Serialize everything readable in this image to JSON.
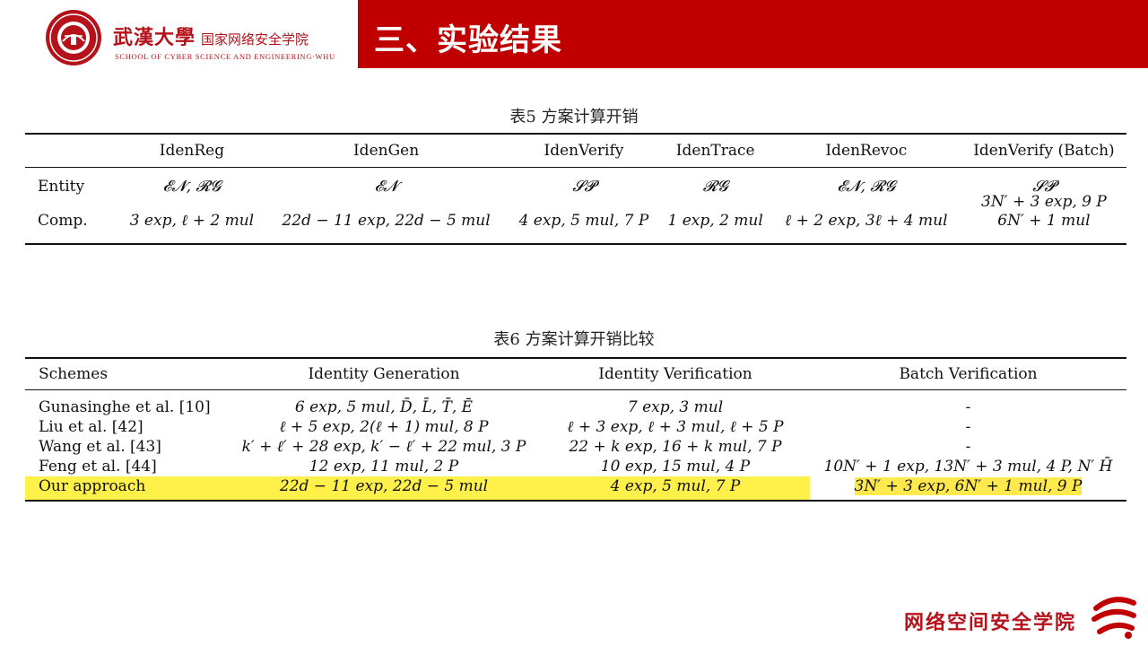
{
  "header": {
    "university_name": "武漢大學",
    "school_name": "国家网络安全学院",
    "school_english": "SCHOOL OF CYBER SCIENCE AND ENGINEERING·WHU",
    "section_title": "三、实验结果",
    "accent_color": "#c00000"
  },
  "table5": {
    "caption": "表5  方案计算开销",
    "columns": [
      "",
      "IdenReg",
      "IdenGen",
      "IdenVerify",
      "IdenTrace",
      "IdenRevoc",
      "IdenVerify (Batch)"
    ],
    "rows": [
      {
        "label": "Entity",
        "cells": [
          "𝓔𝓝, 𝓡𝓖",
          "𝓔𝓝",
          "𝓢𝓟",
          "𝓡𝓖",
          "𝓔𝓝, 𝓡𝓖",
          "𝓢𝓟"
        ]
      },
      {
        "label": "Comp.",
        "cells": [
          "3 exp, ℓ + 2 mul",
          "22d − 11 exp, 22d − 5 mul",
          "4 exp, 5 mul, 7 P",
          "1 exp, 2 mul",
          "ℓ + 2 exp, 3ℓ + 4 mul",
          "3N′ + 3 exp, 9 P"
        ],
        "batch_second_line": "6N′ + 1 mul"
      }
    ]
  },
  "table6": {
    "caption": "表6  方案计算开销比较",
    "columns": [
      "Schemes",
      "Identity Generation",
      "Identity Verification",
      "Batch Verification"
    ],
    "rows": [
      {
        "scheme": "Gunasinghe et al. [10]",
        "generation": "6 exp, 5 mul, D̄, L̄, T̄, Ē",
        "verification": "7 exp, 3 mul",
        "batch": "-"
      },
      {
        "scheme": "Liu et al. [42]",
        "generation": "ℓ + 5 exp, 2(ℓ + 1) mul, 8 P",
        "verification": "ℓ + 3 exp, ℓ + 3 mul, ℓ + 5 P",
        "batch": "-"
      },
      {
        "scheme": "Wang et al. [43]",
        "generation": "k′ + ℓ′ + 28 exp, k′ − ℓ′ + 22 mul, 3 P",
        "verification": "22 + k exp, 16 + k mul, 7 P",
        "batch": "-"
      },
      {
        "scheme": "Feng et al. [44]",
        "generation": "12 exp, 11 mul, 2 P",
        "verification": "10 exp, 15 mul, 4 P",
        "batch": "10N′ + 1 exp, 13N′ + 3 mul, 4 P, N′ H̄"
      },
      {
        "scheme": "Our approach",
        "generation": "22d − 11 exp, 22d − 5 mul",
        "verification": "4 exp, 5 mul, 7 P",
        "batch": "3N′ + 3 exp, 6N′ + 1 mul, 9 P",
        "highlighted": true
      }
    ],
    "highlight_color": "#fff04a"
  },
  "footer": {
    "school_name": "网络空间安全学院"
  }
}
